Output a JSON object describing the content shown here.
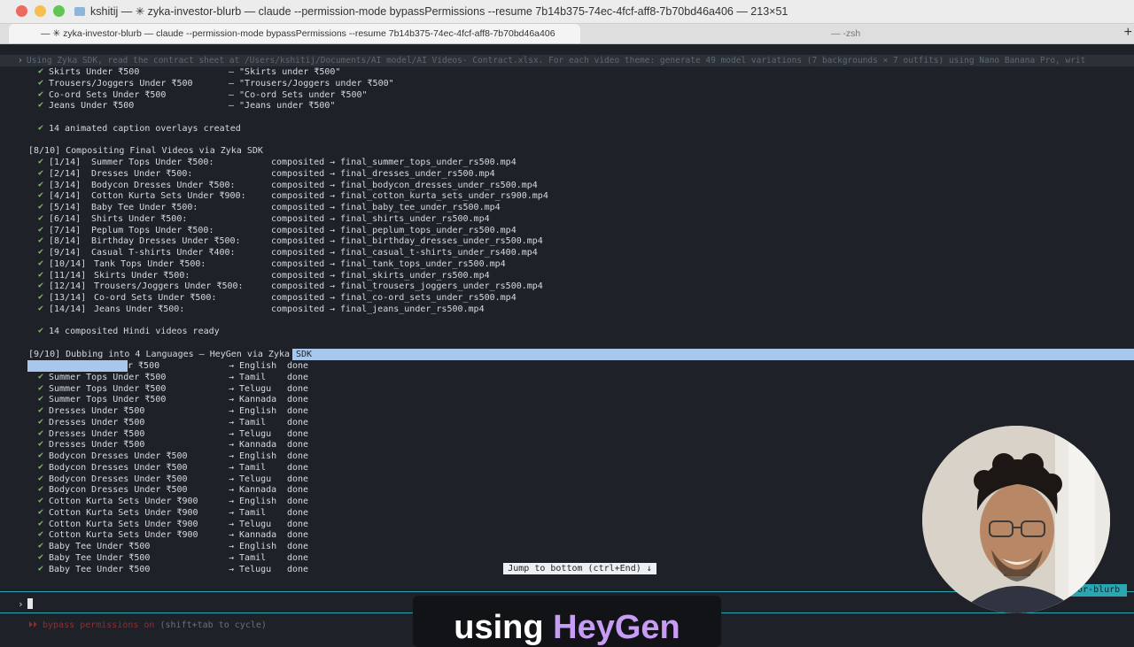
{
  "window": {
    "title": "kshitij — ✳ zyka-investor-blurb — claude --permission-mode bypassPermissions --resume 7b14b375-74ec-4fcf-aff8-7b70bd46a406 — 213×51",
    "tabs": [
      {
        "label": "— ✳ zyka-investor-blurb — claude --permission-mode bypassPermissions --resume 7b14b375-74ec-4fcf-aff8-7b70bd46a406",
        "active": true
      },
      {
        "label": "— -zsh",
        "active": false
      }
    ],
    "new_tab": "+"
  },
  "terminal": {
    "command_line": "Using Zyka SDK, read the contract sheet at /Users/kshitij/Documents/AI model/AI Videos- Contract.xlsx. For each video theme: generate 49 model variations (7 backgrounds × 7 outfits) using Nano Banana Pro, writ",
    "captions_list": [
      {
        "name": "Skirts Under ₹500",
        "caption": "— \"Skirts under ₹500\""
      },
      {
        "name": "Trousers/Joggers Under ₹500",
        "caption": "— \"Trousers/Joggers under ₹500\""
      },
      {
        "name": "Co-ord Sets Under ₹500",
        "caption": "— \"Co-ord Sets under ₹500\""
      },
      {
        "name": "Jeans Under ₹500",
        "caption": "— \"Jeans under ₹500\""
      }
    ],
    "captions_summary": "14 animated caption overlays created",
    "composite_header": "[8/10] Compositing Final Videos via Zyka SDK",
    "composite_rows": [
      {
        "idx": "[1/14]",
        "name": "Summer Tops Under ₹500:",
        "status": "composited",
        "file": "→ final_summer_tops_under_rs500.mp4"
      },
      {
        "idx": "[2/14]",
        "name": "Dresses Under ₹500:",
        "status": "composited",
        "file": "→ final_dresses_under_rs500.mp4"
      },
      {
        "idx": "[3/14]",
        "name": "Bodycon Dresses Under ₹500:",
        "status": "composited",
        "file": "→ final_bodycon_dresses_under_rs500.mp4"
      },
      {
        "idx": "[4/14]",
        "name": "Cotton Kurta Sets Under ₹900:",
        "status": "composited",
        "file": "→ final_cotton_kurta_sets_under_rs900.mp4"
      },
      {
        "idx": "[5/14]",
        "name": "Baby Tee Under ₹500:",
        "status": "composited",
        "file": "→ final_baby_tee_under_rs500.mp4"
      },
      {
        "idx": "[6/14]",
        "name": "Shirts Under ₹500:",
        "status": "composited",
        "file": "→ final_shirts_under_rs500.mp4"
      },
      {
        "idx": "[7/14]",
        "name": "Peplum Tops Under ₹500:",
        "status": "composited",
        "file": "→ final_peplum_tops_under_rs500.mp4"
      },
      {
        "idx": "[8/14]",
        "name": "Birthday Dresses Under ₹500:",
        "status": "composited",
        "file": "→ final_birthday_dresses_under_rs500.mp4"
      },
      {
        "idx": "[9/14]",
        "name": "Casual T-shirts Under ₹400:",
        "status": "composited",
        "file": "→ final_casual_t-shirts_under_rs400.mp4"
      },
      {
        "idx": "[10/14]",
        "name": "Tank Tops Under ₹500:",
        "status": "composited",
        "file": "→ final_tank_tops_under_rs500.mp4"
      },
      {
        "idx": "[11/14]",
        "name": "Skirts Under ₹500:",
        "status": "composited",
        "file": "→ final_skirts_under_rs500.mp4"
      },
      {
        "idx": "[12/14]",
        "name": "Trousers/Joggers Under ₹500:",
        "status": "composited",
        "file": "→ final_trousers_joggers_under_rs500.mp4"
      },
      {
        "idx": "[13/14]",
        "name": "Co-ord Sets Under ₹500:",
        "status": "composited",
        "file": "→ final_co-ord_sets_under_rs500.mp4"
      },
      {
        "idx": "[14/14]",
        "name": "Jeans Under ₹500:",
        "status": "composited",
        "file": "→ final_jeans_under_rs500.mp4"
      }
    ],
    "composite_summary": "14 composited Hindi videos ready",
    "dub_header": "[9/10] Dubbing into 4 Languages — HeyGen via Zyka",
    "dub_header_selected": " SDK",
    "dub_first_partial": "r ₹500",
    "dub_rows": [
      {
        "name": "Summer Tops Under ₹500",
        "lang": "→ English",
        "status": "done"
      },
      {
        "name": "Summer Tops Under ₹500",
        "lang": "→ Tamil",
        "status": "done"
      },
      {
        "name": "Summer Tops Under ₹500",
        "lang": "→ Telugu",
        "status": "done"
      },
      {
        "name": "Summer Tops Under ₹500",
        "lang": "→ Kannada",
        "status": "done"
      },
      {
        "name": "Dresses Under ₹500",
        "lang": "→ English",
        "status": "done"
      },
      {
        "name": "Dresses Under ₹500",
        "lang": "→ Tamil",
        "status": "done"
      },
      {
        "name": "Dresses Under ₹500",
        "lang": "→ Telugu",
        "status": "done"
      },
      {
        "name": "Dresses Under ₹500",
        "lang": "→ Kannada",
        "status": "done"
      },
      {
        "name": "Bodycon Dresses Under ₹500",
        "lang": "→ English",
        "status": "done"
      },
      {
        "name": "Bodycon Dresses Under ₹500",
        "lang": "→ Tamil",
        "status": "done"
      },
      {
        "name": "Bodycon Dresses Under ₹500",
        "lang": "→ Telugu",
        "status": "done"
      },
      {
        "name": "Bodycon Dresses Under ₹500",
        "lang": "→ Kannada",
        "status": "done"
      },
      {
        "name": "Cotton Kurta Sets Under ₹900",
        "lang": "→ English",
        "status": "done"
      },
      {
        "name": "Cotton Kurta Sets Under ₹900",
        "lang": "→ Tamil",
        "status": "done"
      },
      {
        "name": "Cotton Kurta Sets Under ₹900",
        "lang": "→ Telugu",
        "status": "done"
      },
      {
        "name": "Cotton Kurta Sets Under ₹900",
        "lang": "→ Kannada",
        "status": "done"
      },
      {
        "name": "Baby Tee Under ₹500",
        "lang": "→ English",
        "status": "done"
      },
      {
        "name": "Baby Tee Under ₹500",
        "lang": "→ Tamil",
        "status": "done"
      },
      {
        "name": "Baby Tee Under ₹500",
        "lang": "→ Telugu",
        "status": "done"
      }
    ],
    "check_mark": "✔",
    "jump_button": "Jump to bottom (ctrl+End) ↓",
    "prompt_caret": "›",
    "hint_prefix": "⏵⏵ bypass permissions on",
    "hint_suffix": "(shift+tab to cycle)",
    "session_chip": "stor-blurb"
  },
  "overlay_caption": {
    "prefix": "using ",
    "accent": "HeyGen"
  },
  "colors": {
    "accent": "#2aa6b3",
    "selection": "#a7c7ec",
    "check": "#86b86a",
    "caption_accent": "#c69cf5"
  }
}
